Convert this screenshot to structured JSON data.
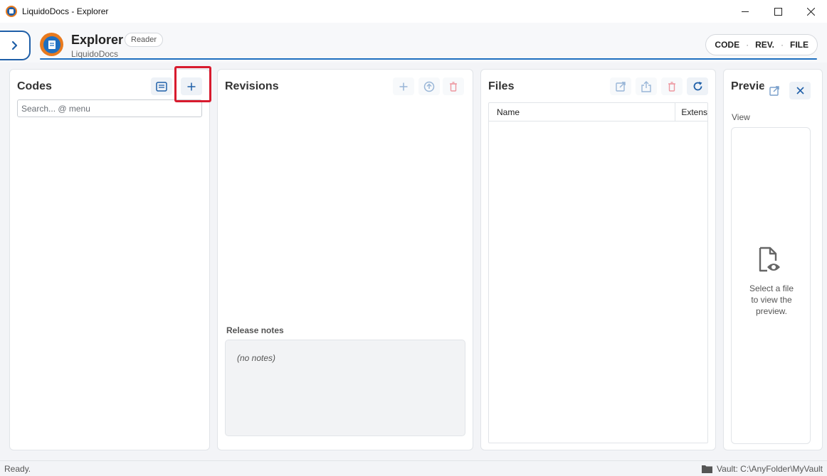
{
  "window": {
    "title": "LiquidoDocs - Explorer"
  },
  "header": {
    "title": "Explorer",
    "subtitle": "LiquidoDocs",
    "role_badge": "Reader",
    "breadcrumb": [
      "CODE",
      "REV.",
      "FILE"
    ],
    "accent_color": "#1f6fc0",
    "logo_color": "#e87a1e"
  },
  "codes_panel": {
    "title": "Codes",
    "search_placeholder": "Search... @ menu",
    "search_value": ""
  },
  "revisions_panel": {
    "title": "Revisions",
    "release_notes_label": "Release notes",
    "release_notes_text": "(no notes)"
  },
  "files_panel": {
    "title": "Files",
    "columns": [
      "Name",
      "Extens"
    ]
  },
  "preview_panel": {
    "title": "Previe",
    "view_label": "View",
    "empty_message": "Select a file to view the preview."
  },
  "status": {
    "left": "Ready.",
    "vault": "Vault: C:\\AnyFolder\\MyVault"
  },
  "icons": {
    "minimize": "minimize-icon",
    "maximize": "maximize-icon",
    "close": "close-icon",
    "sidebar_toggle": "chevron-right-icon",
    "list": "list-icon",
    "add": "plus-icon",
    "upload": "upload-icon",
    "delete": "trash-icon",
    "open_external": "open-external-icon",
    "share": "share-icon",
    "refresh": "refresh-icon",
    "preview_file": "file-eye-icon",
    "folder": "folder-icon"
  },
  "highlight_color": "#d81b2e"
}
